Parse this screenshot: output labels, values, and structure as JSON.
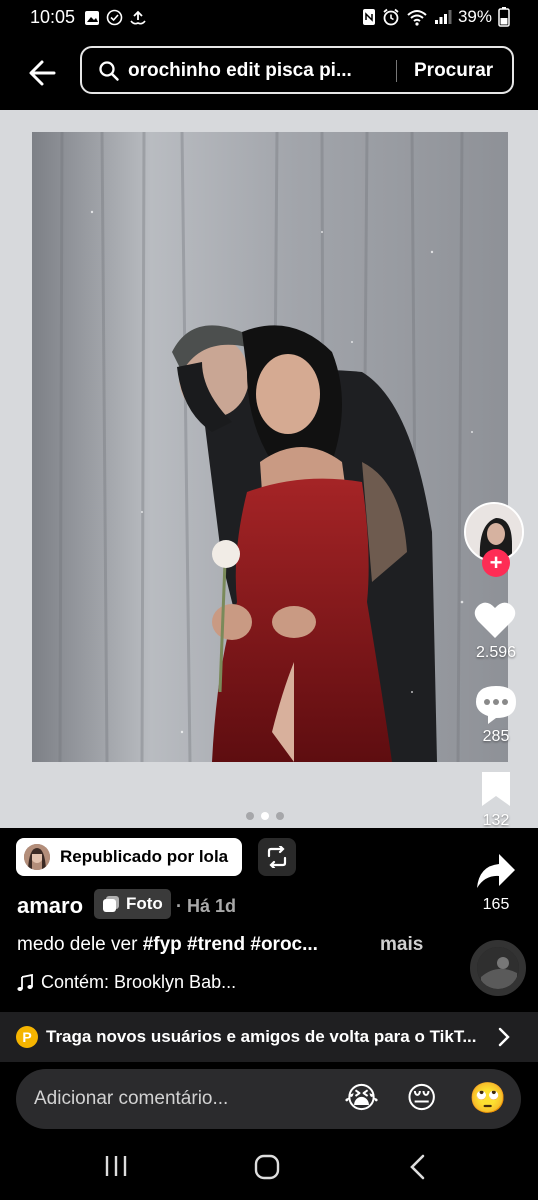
{
  "status_bar": {
    "time": "10:05",
    "battery": "39%",
    "left_icons": [
      "gallery-icon",
      "check-circle-icon",
      "upload-icon"
    ],
    "right_icons": [
      "nfc-icon",
      "alarm-icon",
      "wifi-icon",
      "signal-icon",
      "battery-icon"
    ]
  },
  "header": {
    "back_icon": "arrow-left-icon",
    "search_icon": "search-icon",
    "query": "orochinho edit pisca pi...",
    "search_button": "Procurar"
  },
  "carousel": {
    "page_count": 3,
    "current_page": 2
  },
  "rail": {
    "like_count": "2.596",
    "comment_count": "285",
    "bookmark_count": "132",
    "share_count": "165",
    "follow_symbol": "+"
  },
  "post": {
    "repost_label": "Republicado por lola",
    "author": "amaro",
    "type_tag": "Foto",
    "time": "· Há 1d",
    "caption_text": "medo dele ver ",
    "caption_tags": "#fyp #trend #oroc...",
    "more_label": "mais",
    "music": "Contém: Brooklyn Bab...",
    "music_icon": "music-note-icon"
  },
  "banner": {
    "coin_letter": "P",
    "text": "Traga novos usuários e amigos de volta para o TikT..."
  },
  "comment_bar": {
    "placeholder": "Adicionar comentário...",
    "emojis": [
      "😭",
      "😔",
      "🙄"
    ]
  },
  "nav": {
    "recents_icon": "recents-icon",
    "home_icon": "home-icon",
    "back_icon": "back-nav-icon"
  },
  "colors": {
    "accent": "#fe2c55",
    "coin": "#f5b400",
    "photo_bg": "#d7d9dc",
    "dress": "#8e1a1c"
  }
}
